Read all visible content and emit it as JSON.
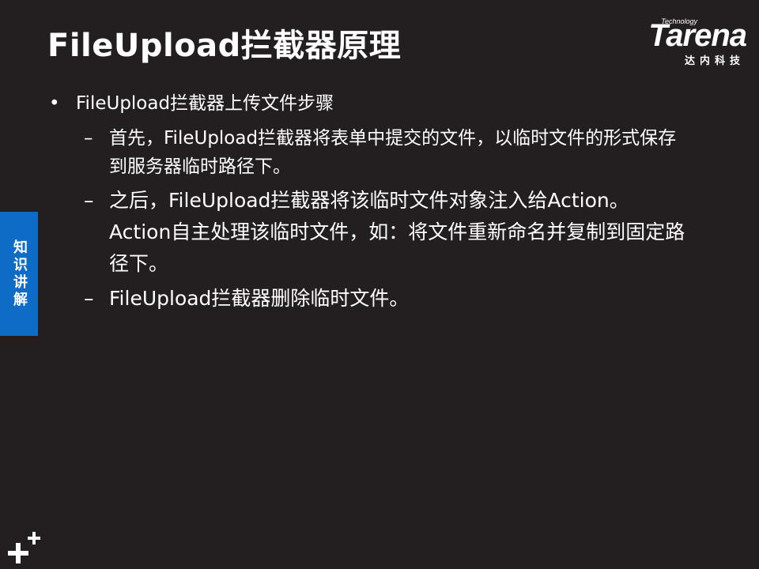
{
  "slide": {
    "title": "FileUpload拦截器原理"
  },
  "logo": {
    "tech": "Technology",
    "word": "Tarena",
    "cn": "达内科技"
  },
  "side_tab": {
    "label": "知识讲解"
  },
  "content": {
    "bullet_marker": "•",
    "sub_marker": "–",
    "heading": "FileUpload拦截器上传文件步骤",
    "steps": [
      "首先，FileUpload拦截器将表单中提交的文件，以临时文件的形式保存到服务器临时路径下。",
      "之后，FileUpload拦截器将该临时文件对象注入给Action。Action自主处理该临时文件，如：将文件重新命名并复制到固定路径下。",
      "FileUpload拦截器删除临时文件。"
    ]
  },
  "colors": {
    "background": "#231f20",
    "text": "#ffffff",
    "side_tab": "#0e6bc6"
  }
}
